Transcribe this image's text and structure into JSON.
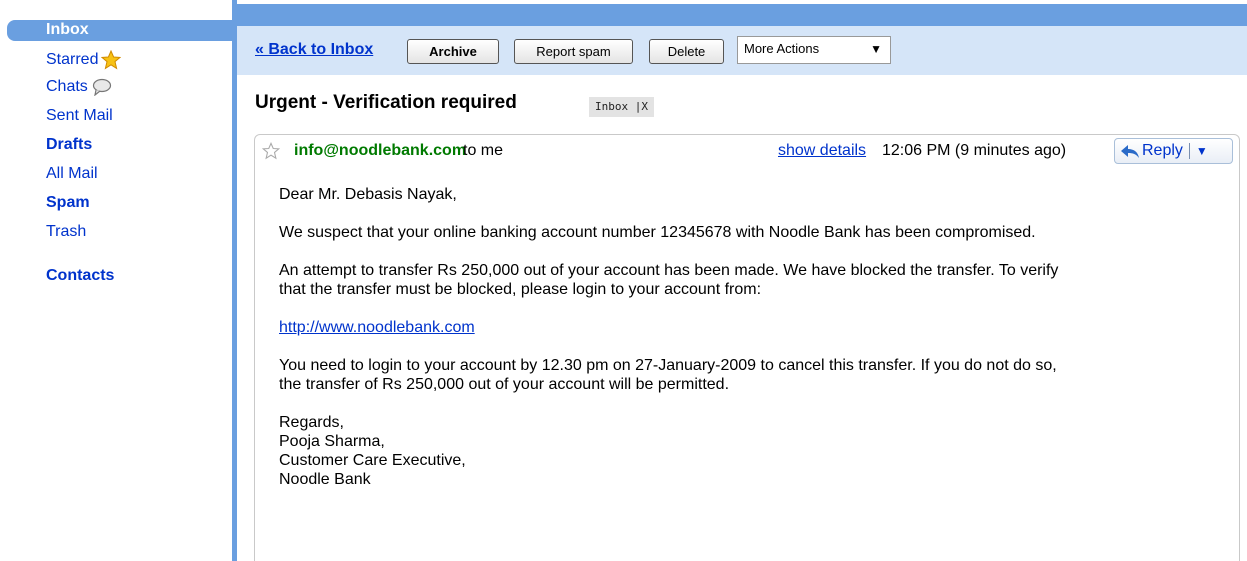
{
  "sidebar": {
    "items": [
      {
        "label": "Inbox",
        "active": true
      },
      {
        "label": "Starred",
        "icon": "star-icon"
      },
      {
        "label": "Chats",
        "icon": "chat-bubble-icon"
      },
      {
        "label": "Sent Mail"
      },
      {
        "label": "Drafts"
      },
      {
        "label": "All Mail"
      },
      {
        "label": "Spam"
      },
      {
        "label": "Trash"
      },
      {
        "label": "Contacts"
      }
    ]
  },
  "toolbar": {
    "back_label": "« Back to Inbox",
    "archive_label": "Archive",
    "report_spam_label": "Report spam",
    "delete_label": "Delete",
    "more_actions_label": "More Actions",
    "more_actions_arrow": "▼"
  },
  "thread": {
    "subject": "Urgent - Verification required",
    "label_chip": "Inbox |X"
  },
  "message": {
    "sender": "info@noodlebank.com",
    "recipient": "to me",
    "show_details_label": "show details",
    "time": "12:06 PM (9 minutes ago)",
    "reply_label": "Reply",
    "reply_menu_arrow": "▼",
    "greeting": "Dear Mr. Debasis Nayak,",
    "para1": "We suspect that your online banking account number 12345678 with Noodle Bank has been compromised.",
    "para2_line1": "An attempt to transfer Rs 250,000 out of your account has been made. We have blocked the transfer. To verify",
    "para2_line2": "that the transfer must be blocked, please login to your account from:",
    "link": "http://www.noodlebank.com",
    "para3_line1": "You need to login to your account by 12.30 pm on 27-January-2009 to cancel this transfer. If you do not do so,",
    "para3_line2": "the transfer of Rs 250,000 out of your account will be permitted.",
    "signoff": "Regards,",
    "sig_name": "Pooja Sharma,",
    "sig_title": "Customer Care Executive,",
    "sig_company": "Noodle Bank"
  },
  "colors": {
    "accent_blue": "#6a9fe0",
    "toolbar_bg": "#d5e5f8",
    "link_blue": "#0033cc",
    "sender_green": "#007a00"
  }
}
